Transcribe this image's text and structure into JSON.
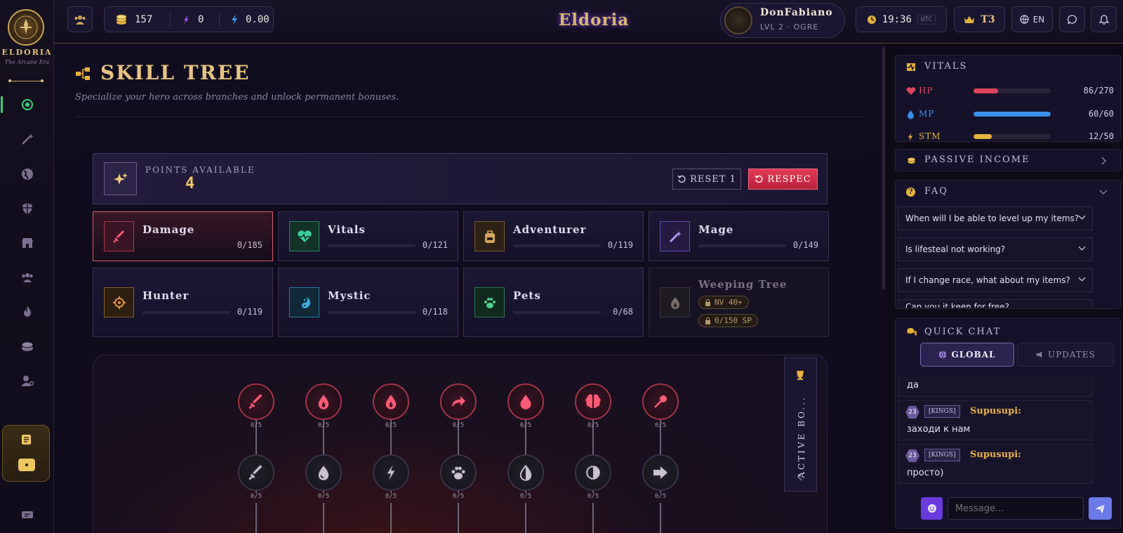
{
  "brand": {
    "name": "ELDORIA",
    "tagline": "The Arcane Era",
    "header_logo": "Eldoria"
  },
  "header": {
    "gold": "157",
    "shards": "0",
    "energy": "0.00",
    "player": {
      "name": "DonFabiano",
      "level_race": "LVL 2 · OGRE"
    },
    "time": "19:36",
    "timezone": "UTC",
    "tier": "T3",
    "language": "EN"
  },
  "page": {
    "title": "SKILL TREE",
    "subtitle": "Specialize your hero across branches and unlock permanent bonuses."
  },
  "points": {
    "label": "POINTS AVAILABLE",
    "value": "4",
    "reset_label": "RESET 1",
    "respec_label": "RESPEC"
  },
  "branches": [
    {
      "name": "Damage",
      "count": "0/185",
      "icon": "sword-icon",
      "color": "#e0445c"
    },
    {
      "name": "Vitals",
      "count": "0/121",
      "icon": "heart-pulse-icon",
      "color": "#3ad1a0"
    },
    {
      "name": "Adventurer",
      "count": "0/119",
      "icon": "backpack-icon",
      "color": "#d9a55a"
    },
    {
      "name": "Mage",
      "count": "0/149",
      "icon": "wand-icon",
      "color": "#9a7aff"
    },
    {
      "name": "Hunter",
      "count": "0/119",
      "icon": "target-icon",
      "color": "#e8913a"
    },
    {
      "name": "Mystic",
      "count": "0/118",
      "icon": "yin-yang-icon",
      "color": "#3ab0e0"
    },
    {
      "name": "Pets",
      "count": "0/68",
      "icon": "paw-icon",
      "color": "#4ad18a"
    },
    {
      "name": "Weeping Tree",
      "locked": true,
      "req_level": "NV 40+",
      "req_sp": "0/150 SP",
      "icon": "flame-icon",
      "color": "#8a7a6a"
    }
  ],
  "tree": {
    "active_label": "ACTIVE BO...",
    "row1": [
      {
        "icon": "sword-icon",
        "count": "0/5"
      },
      {
        "icon": "flame-icon",
        "count": "0/5"
      },
      {
        "icon": "flame-icon",
        "count": "0/5"
      },
      {
        "icon": "redirect-arrow-icon",
        "count": "0/5"
      },
      {
        "icon": "blood-drop-icon",
        "count": "0/5"
      },
      {
        "icon": "brain-icon",
        "count": "0/5"
      },
      {
        "icon": "needle-icon",
        "count": "0/5"
      }
    ],
    "row2": [
      {
        "icon": "sword-icon",
        "count": "0/5"
      },
      {
        "icon": "water-drop-icon",
        "count": "0/5"
      },
      {
        "icon": "lightning-icon",
        "count": "0/5"
      },
      {
        "icon": "paw-icon",
        "count": "0/5"
      },
      {
        "icon": "half-drop-icon",
        "count": "0/5"
      },
      {
        "icon": "half-circle-icon",
        "count": "0/5"
      },
      {
        "icon": "arrow-right-icon",
        "count": "0/5"
      }
    ]
  },
  "vitals": {
    "title": "VITALS",
    "hp": {
      "label": "HP",
      "value": "86/270",
      "fraction": 0.32,
      "color": "#e0445c"
    },
    "mp": {
      "label": "MP",
      "value": "60/60",
      "fraction": 1.0,
      "color": "#3a8fe8"
    },
    "stm": {
      "label": "STM",
      "value": "12/50",
      "fraction": 0.24,
      "color": "#e8b23a"
    }
  },
  "passive_income": {
    "title": "PASSIVE INCOME"
  },
  "faq": {
    "title": "FAQ",
    "items": [
      "When will I be able to level up my items?",
      "Is lifesteal not working?",
      "If I change race, what about my items?",
      "Can you it keep for free?"
    ]
  },
  "chat": {
    "title": "QUICK CHAT",
    "tab_global": "GLOBAL",
    "tab_updates": "UPDATES",
    "partial_message": "да",
    "messages": [
      {
        "level": "23",
        "clan": "[KINGS]",
        "user": "Supusupi:",
        "text": "заходи к нам"
      },
      {
        "level": "23",
        "clan": "[KINGS]",
        "user": "Supusupi:",
        "text": "просто)"
      }
    ],
    "input_placeholder": "Message..."
  }
}
